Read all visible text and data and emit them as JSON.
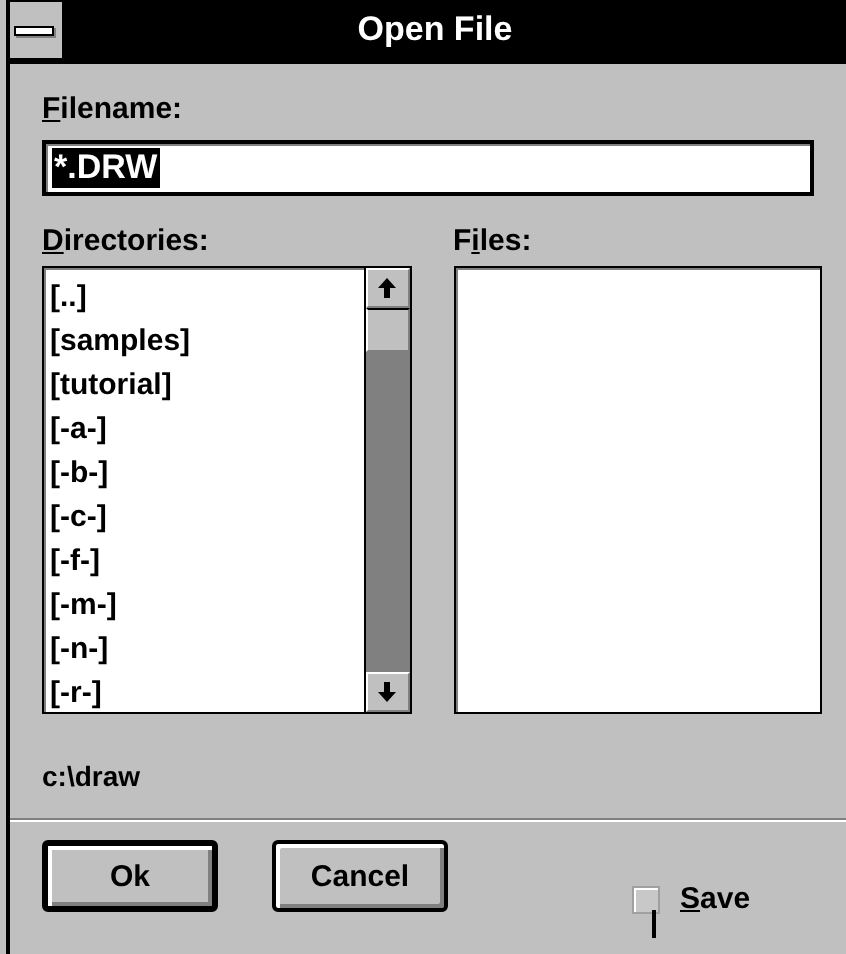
{
  "window": {
    "title": "Open File"
  },
  "filename": {
    "label": {
      "key": "F",
      "after": "ilename:"
    },
    "value": "*.DRW",
    "selected": true
  },
  "directories": {
    "label": {
      "key": "D",
      "after": "irectories:"
    },
    "items": [
      {
        "text": "[..]",
        "selected": false
      },
      {
        "text": "[samples]",
        "selected": false
      },
      {
        "text": "[tutorial]",
        "selected": false
      },
      {
        "text": "[-a-]",
        "selected": false
      },
      {
        "text": "[-b-]",
        "selected": false
      },
      {
        "text": "[-c-]",
        "selected": false
      },
      {
        "text": "[-f-]",
        "selected": false
      },
      {
        "text": "[-m-]",
        "selected": false
      },
      {
        "text": "[-n-]",
        "selected": false
      },
      {
        "text": "[-r-]",
        "selected": false
      }
    ]
  },
  "files": {
    "label": {
      "before": "F",
      "key": "i",
      "after": "les:"
    }
  },
  "path": "c:\\draw",
  "buttons": [
    {
      "label": "Ok",
      "default": true
    },
    {
      "label": "Cancel",
      "default": false
    }
  ],
  "save": {
    "label": {
      "key": "S",
      "after": "ave"
    },
    "checked": false,
    "disabled": true
  }
}
